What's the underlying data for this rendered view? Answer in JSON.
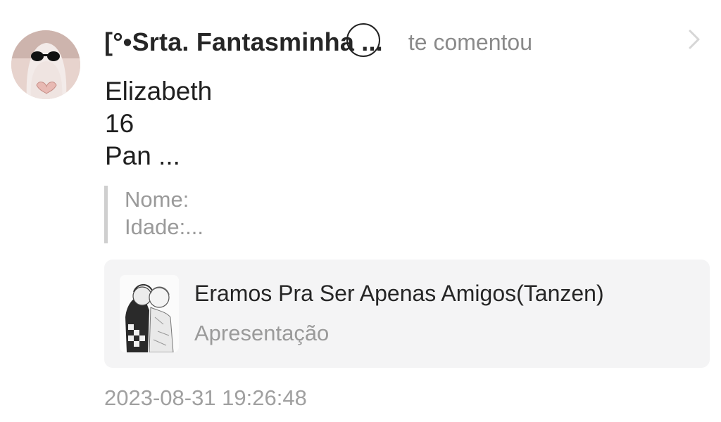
{
  "notification": {
    "author": "[°•Srta. Fantasminha ...",
    "action": "te comentou",
    "body_lines": [
      "Elizabeth",
      "16",
      "Pan ..."
    ],
    "quote_lines": [
      "Nome:",
      "Idade:..."
    ],
    "post": {
      "title": "Eramos Pra Ser Apenas Amigos(Tanzen)",
      "subtitle": "Apresentação",
      "thumbnail_icon": "manga-couple-thumbnail"
    },
    "timestamp": "2023-08-31 19:26:48",
    "avatar_icon": "ghost-with-sunglasses-avatar",
    "chevron_icon": "chevron-right-icon"
  }
}
